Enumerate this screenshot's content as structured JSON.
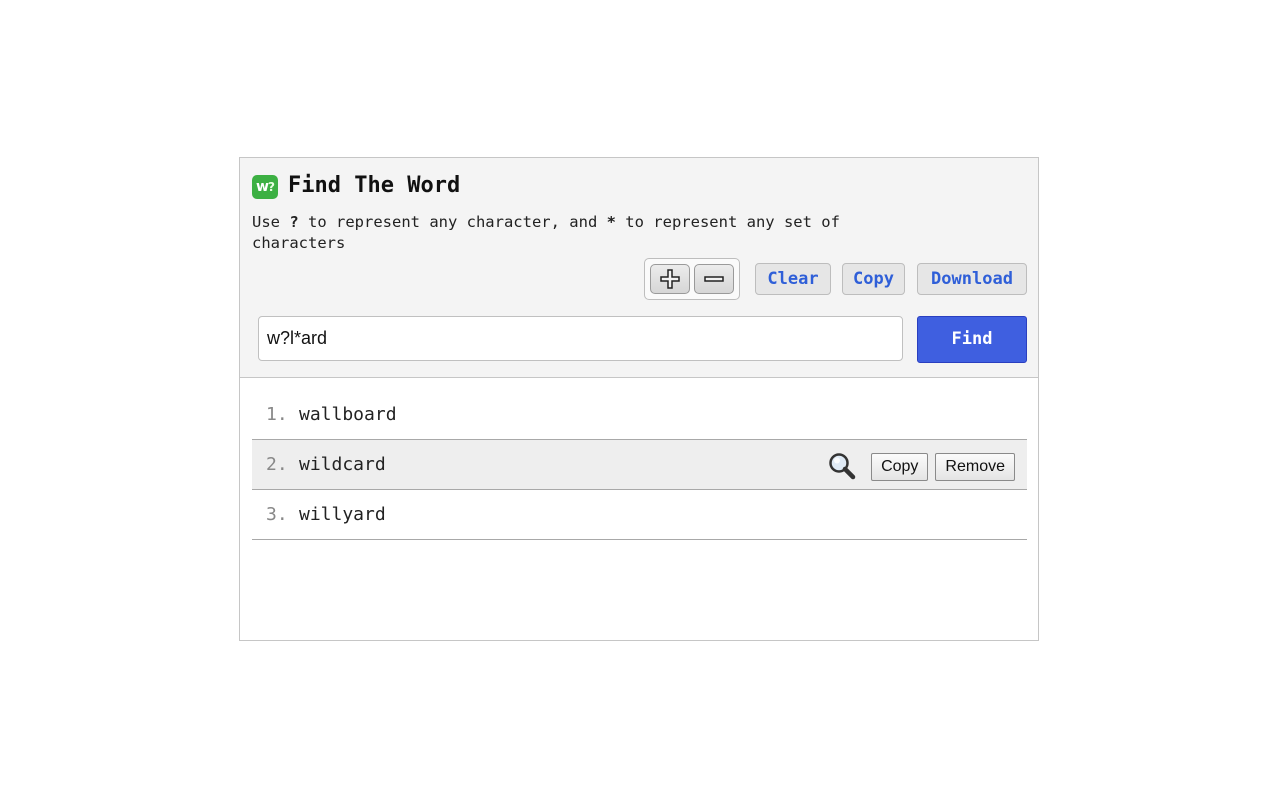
{
  "app": {
    "logo_text": "w",
    "logo_q": "?",
    "title": "Find The Word",
    "instruction": {
      "p1": "Use ",
      "q_sym": "?",
      "p2": " to represent any character, and ",
      "star_sym": "*",
      "p3": " to represent any set of characters"
    }
  },
  "toolbar": {
    "zoom_in_icon": "plus-icon",
    "zoom_out_icon": "minus-icon",
    "clear_label": "Clear",
    "copy_label": "Copy",
    "download_label": "Download"
  },
  "search": {
    "value": "w?l*ard",
    "find_label": "Find"
  },
  "results": [
    {
      "num": "1.",
      "word": "wallboard"
    },
    {
      "num": "2.",
      "word": "wildcard"
    },
    {
      "num": "3.",
      "word": "willyard"
    }
  ],
  "row_actions": {
    "icon": "magnifier-icon",
    "copy_label": "Copy",
    "remove_label": "Remove"
  },
  "colors": {
    "accent": "#3f5fe0",
    "link_text": "#2f5fd8",
    "logo": "#3cb043"
  }
}
